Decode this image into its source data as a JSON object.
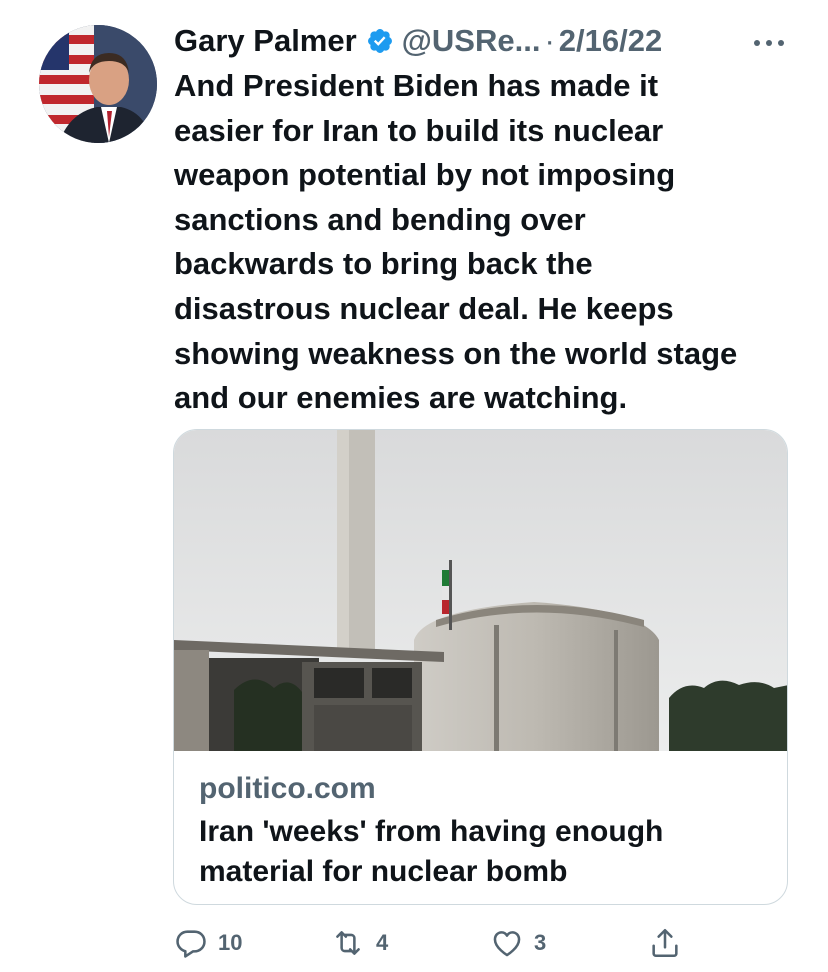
{
  "author": {
    "name": "Gary Palmer",
    "handle": "@USRe...",
    "separator": "·",
    "date": "2/16/22",
    "verified": true,
    "avatar_icon": "profile-avatar"
  },
  "tweet": {
    "text_lines": [
      "And President Biden has made it",
      "easier for Iran to build its nuclear",
      "weapon potential by not imposing",
      "sanctions and bending over",
      "backwards to bring back the",
      "disastrous nuclear deal. He keeps",
      "showing weakness on the world stage",
      "and our enemies are watching."
    ]
  },
  "card": {
    "domain": "politico.com",
    "title_lines": [
      "Iran 'weeks' from having enough",
      "material for nuclear bomb"
    ]
  },
  "actions": {
    "replies": "10",
    "retweets": "4",
    "likes": "3"
  },
  "colors": {
    "text": "#0f1419",
    "secondary": "#536471",
    "verified_blue": "#1d9bf0",
    "border": "#cfd9de"
  }
}
